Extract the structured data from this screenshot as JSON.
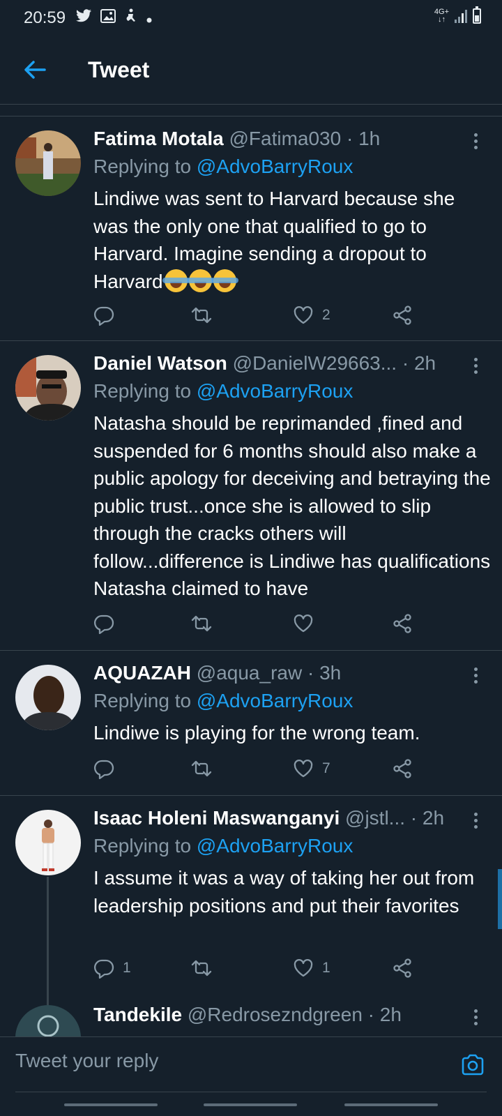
{
  "status_bar": {
    "time": "20:59",
    "network": "4G+"
  },
  "header": {
    "title": "Tweet"
  },
  "tweets": [
    {
      "name": "Fatima Motala",
      "handle": "@Fatima030",
      "time": "· 1h",
      "replying_prefix": "Replying to",
      "replying_to": "@AdvoBarryRoux",
      "text": "Lindiwe was sent to Harvard because she was the only one that qualified to go to Harvard. Imagine sending a dropout to Harvard",
      "emoji": "😂😂😂",
      "replies": "",
      "retweets": "",
      "likes": "2"
    },
    {
      "name": "Daniel Watson",
      "handle": "@DanielW29663...",
      "time": "· 2h",
      "replying_prefix": "Replying to",
      "replying_to": "@AdvoBarryRoux",
      "text": "Natasha should be reprimanded ,fined and suspended for 6 months should also make a public apology for deceiving and betraying the public trust...once she is allowed to slip through the cracks others will follow...difference is Lindiwe has qualifications Natasha claimed to have",
      "replies": "",
      "retweets": "",
      "likes": ""
    },
    {
      "name": "AQUAZAH",
      "handle": "@aqua_raw",
      "time": "· 3h",
      "replying_prefix": "Replying to",
      "replying_to": "@AdvoBarryRoux",
      "text": "Lindiwe is playing for the wrong team.",
      "replies": "",
      "retweets": "",
      "likes": "7"
    },
    {
      "name": "Isaac Holeni Maswanganyi",
      "handle": "@jstl...",
      "time": "· 2h",
      "replying_prefix": "Replying to",
      "replying_to": "@AdvoBarryRoux",
      "text": "I assume it was a way of taking her out from leadership positions and put their favorites",
      "replies": "1",
      "retweets": "",
      "likes": "1"
    },
    {
      "name": "Tandekile",
      "handle": "@Redroseznd​green",
      "time": "· 2h"
    }
  ],
  "reply_bar": {
    "placeholder": "Tweet your reply"
  },
  "icons": {
    "back": "arrow-left-icon",
    "more": "more-vertical-icon",
    "reply": "reply-icon",
    "retweet": "retweet-icon",
    "like": "heart-icon",
    "share": "share-icon",
    "camera": "camera-icon"
  },
  "colors": {
    "background": "#15202b",
    "accent": "#1da1f2",
    "muted": "#8899a6",
    "divider": "#38444d"
  }
}
